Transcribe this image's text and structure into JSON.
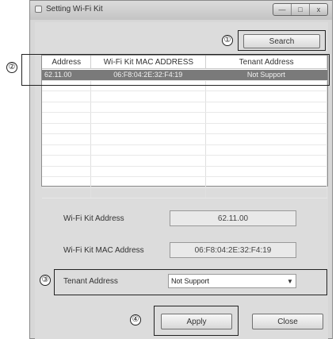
{
  "window": {
    "title": "Setting Wi-Fi Kit",
    "controls": {
      "minimize": "—",
      "maximize": "□",
      "close": "x"
    }
  },
  "toolbar": {
    "search_label": "Search"
  },
  "table": {
    "columns": [
      "Address",
      "Wi-Fi Kit MAC ADDRESS",
      "Tenant Address"
    ],
    "rows": [
      {
        "address": "62.11.00",
        "mac": "06:F8:04:2E:32:F4:19",
        "tenant": "Not Support",
        "selected": true
      }
    ]
  },
  "form": {
    "wifi_kit_address_label": "Wi-Fi Kit Address",
    "wifi_kit_address_value": "62.11.00",
    "mac_address_label": "Wi-Fi Kit MAC Address",
    "mac_address_value": "06:F8:04:2E:32:F4:19",
    "tenant_address_label": "Tenant Address",
    "tenant_address_value": "Not Support"
  },
  "actions": {
    "apply_label": "Apply",
    "close_label": "Close"
  },
  "callouts": {
    "one": "①",
    "two": "②",
    "three": "③",
    "four": "④"
  }
}
